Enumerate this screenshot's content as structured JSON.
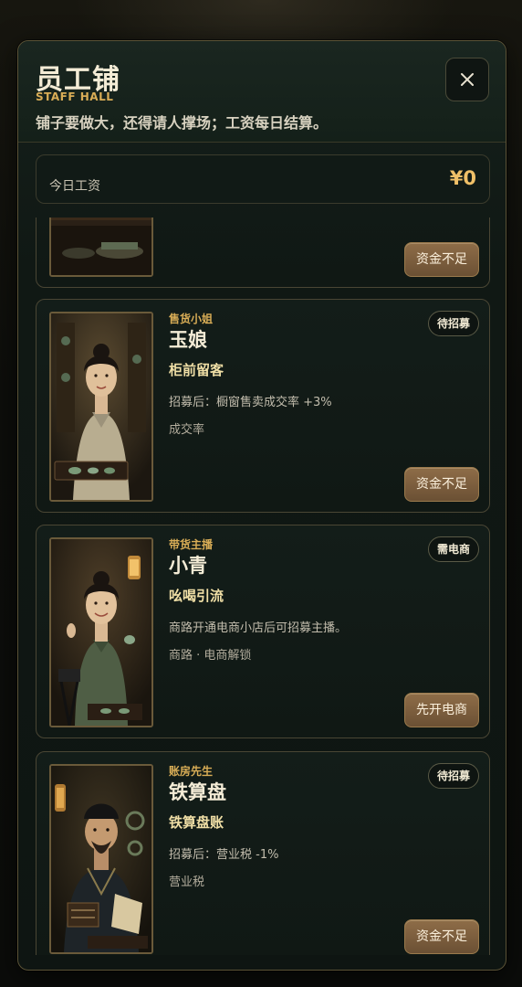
{
  "header": {
    "title": "员工铺",
    "subtitle": "STAFF HALL",
    "tagline": "铺子要做大，还得请人撑场；工资每日结算。"
  },
  "wage": {
    "label": "今日工资",
    "value": "¥0"
  },
  "staff": [
    {
      "role": "",
      "name": "",
      "skill": "",
      "desc": "",
      "tag": "",
      "status": "",
      "action": "资金不足"
    },
    {
      "role": "售货小姐",
      "name": "玉娘",
      "skill": "柜前留客",
      "desc": "招募后：橱窗售卖成交率 +3%",
      "tag": "成交率",
      "status": "待招募",
      "action": "资金不足"
    },
    {
      "role": "带货主播",
      "name": "小青",
      "skill": "吆喝引流",
      "desc": "商路开通电商小店后可招募主播。",
      "tag": "商路 · 电商解锁",
      "status": "需电商",
      "action": "先开电商"
    },
    {
      "role": "账房先生",
      "name": "铁算盘",
      "skill": "铁算盘账",
      "desc": "招募后：营业税 -1%",
      "tag": "营业税",
      "status": "待招募",
      "action": "资金不足"
    }
  ],
  "colors": {
    "accent": "#d9ad56",
    "button": "#7c5e3e",
    "panel": "#101814"
  }
}
